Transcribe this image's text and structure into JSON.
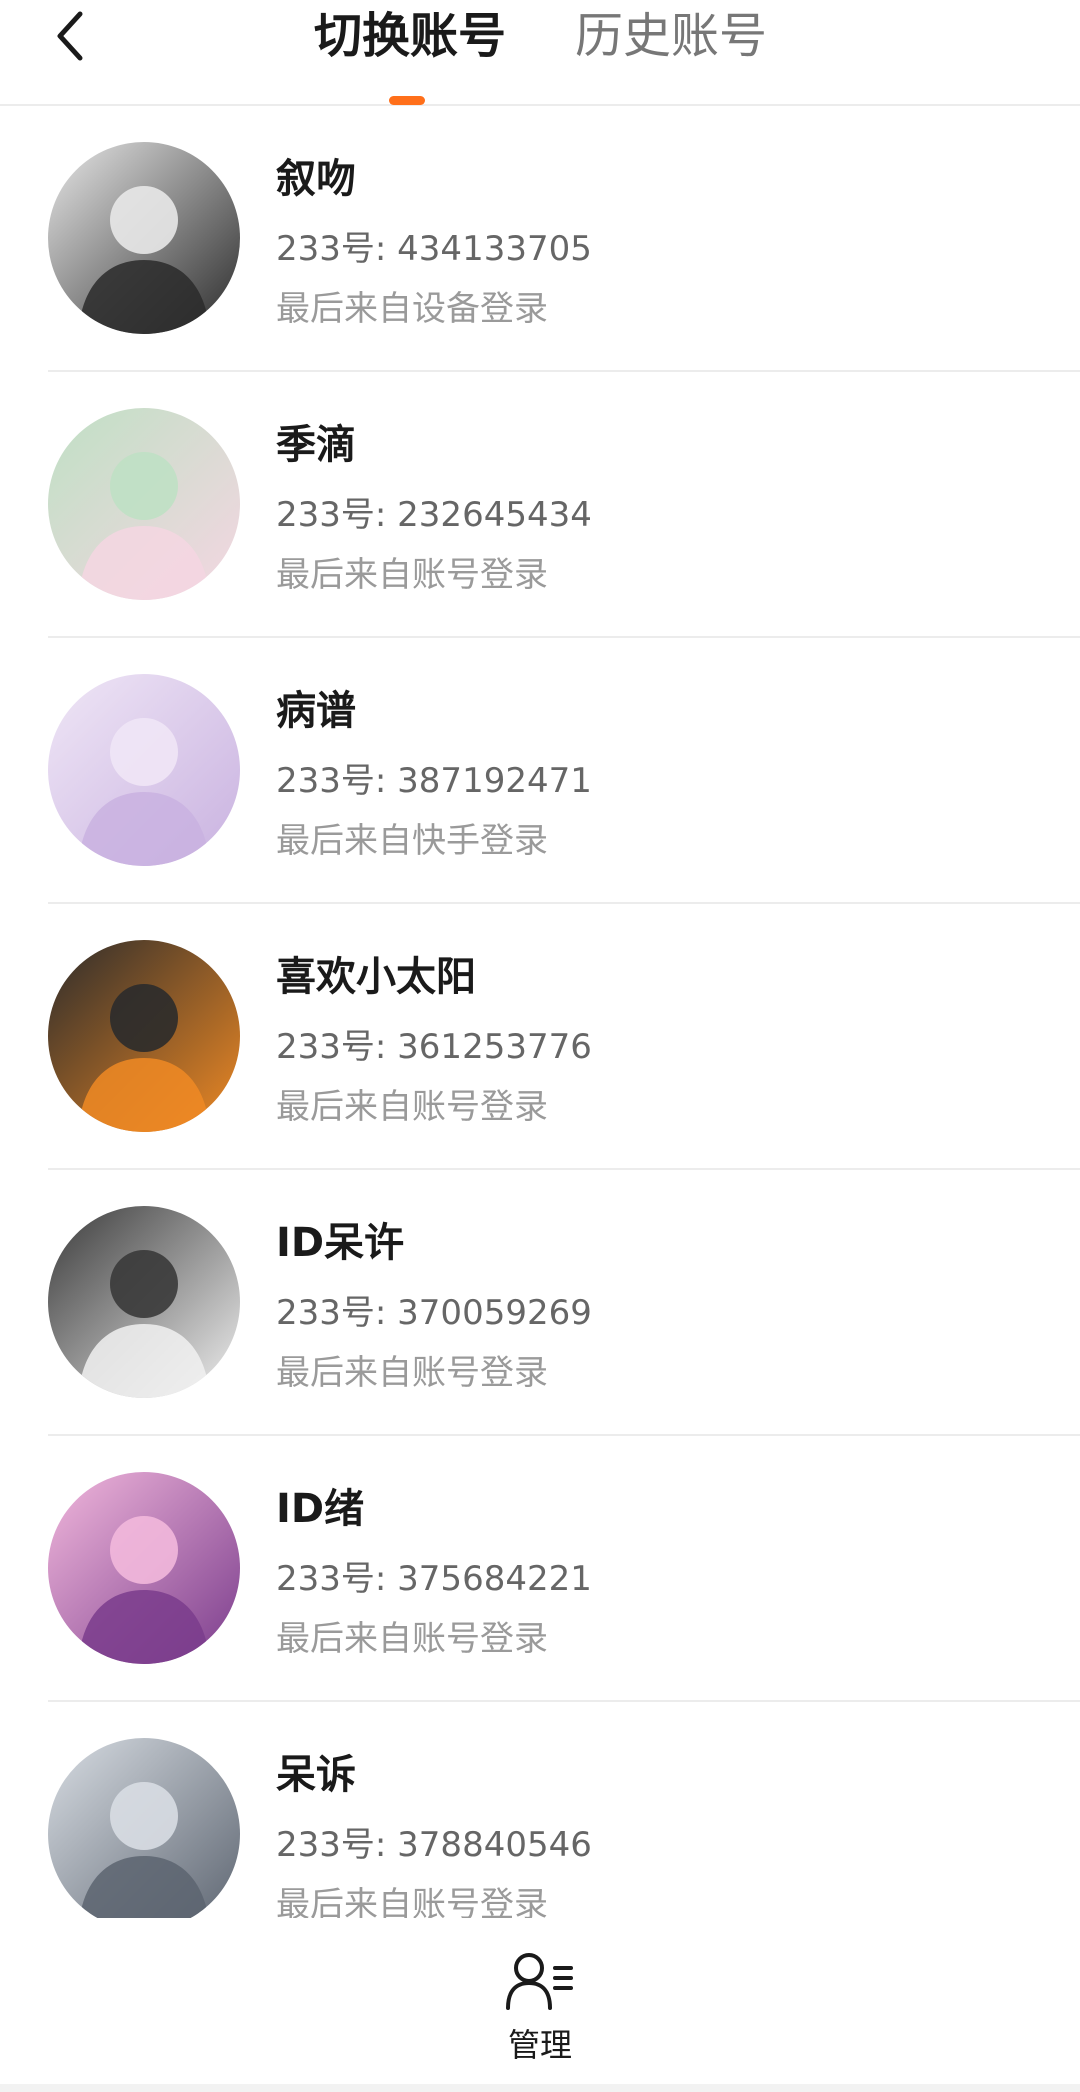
{
  "header": {
    "tabs": [
      {
        "label": "切换账号",
        "active": true
      },
      {
        "label": "历史账号",
        "active": false
      }
    ],
    "accent_color": "#ff6f1a"
  },
  "accounts": [
    {
      "nickname": "叙吻",
      "uid_prefix": "233号: ",
      "uid": "434133705",
      "login_source": "最后来自设备登录",
      "avatar_theme": "monochrome-manga",
      "avatar_colors": [
        "#2a2a2a",
        "#e8e8e8"
      ]
    },
    {
      "nickname": "季滴",
      "uid_prefix": "233号: ",
      "uid": "232645434",
      "login_source": "最后来自账号登录",
      "avatar_theme": "pastel-anime-girl",
      "avatar_colors": [
        "#f4d6e2",
        "#bfe0c4"
      ]
    },
    {
      "nickname": "病谱",
      "uid_prefix": "233号: ",
      "uid": "387192471",
      "login_source": "最后来自快手登录",
      "avatar_theme": "lavender-anime-girl",
      "avatar_colors": [
        "#c9b2e0",
        "#efe6f6"
      ]
    },
    {
      "nickname": "喜欢小太阳",
      "uid_prefix": "233号: ",
      "uid": "361253776",
      "login_source": "最后来自账号登录",
      "avatar_theme": "orange-hair-boy",
      "avatar_colors": [
        "#f08a24",
        "#2b2b2b"
      ]
    },
    {
      "nickname": "ID呆许",
      "uid_prefix": "233号: ",
      "uid": "370059269",
      "login_source": "最后来自账号登录",
      "avatar_theme": "sketch-umbrella",
      "avatar_colors": [
        "#f1f1f1",
        "#3a3a3a"
      ]
    },
    {
      "nickname": "ID绪",
      "uid_prefix": "233号: ",
      "uid": "375684221",
      "login_source": "最后来自账号登录",
      "avatar_theme": "purple-anime-girl",
      "avatar_colors": [
        "#7a3c8c",
        "#f2b8dc"
      ]
    },
    {
      "nickname": "呆诉",
      "uid_prefix": "233号: ",
      "uid": "378840546",
      "login_source": "最后来自账号登录",
      "avatar_theme": "silver-angel-girl",
      "avatar_colors": [
        "#5c6470",
        "#d8dde3"
      ]
    }
  ],
  "bottom": {
    "manage_label": "管理",
    "manage_icon": "user-list-icon"
  }
}
